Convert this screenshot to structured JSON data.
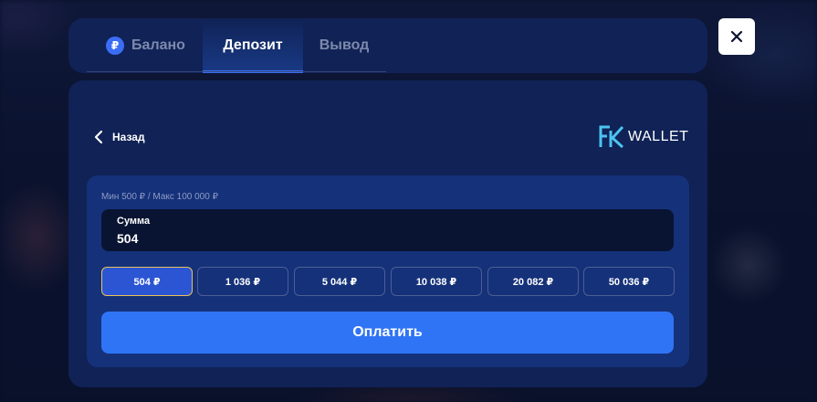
{
  "tabs": [
    {
      "label": "Балано",
      "icon": "ruble-icon",
      "badge": "₽"
    },
    {
      "label": "Депозит"
    },
    {
      "label": "Вывод"
    }
  ],
  "active_tab": "Депозит",
  "back": {
    "label": "Назад"
  },
  "wallet": {
    "logo_mark": "FK",
    "label": "WALLET"
  },
  "deposit": {
    "limits": "Мин 500 ₽ / Макс 100 000 ₽",
    "amount_label": "Сумма",
    "amount_value": "504",
    "presets": [
      "504 ₽",
      "1 036 ₽",
      "5 044 ₽",
      "10 038 ₽",
      "20 082 ₽",
      "50 036 ₽"
    ],
    "selected_preset": "504 ₽",
    "pay_label": "Оплатить"
  },
  "colors": {
    "accent": "#2f74f5",
    "panel": "#102256",
    "selected_border": "#e9c259",
    "wallet_logo": "#4cc3f0"
  }
}
